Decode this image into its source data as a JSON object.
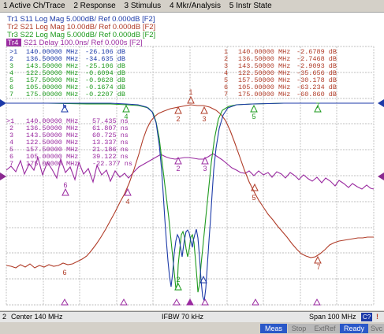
{
  "menu": [
    "1 Active Ch/Trace",
    "2 Response",
    "3 Stimulus",
    "4 Mkr/Analysis",
    "5 Instr State"
  ],
  "traces": [
    {
      "label": "Tr1 S11 Log Mag 5.000dB/ Ref 0.000dB [F2]",
      "color": "#1c3aa8"
    },
    {
      "label": "Tr2 S21 Log Mag 10.00dB/ Ref 0.000dB [F2]",
      "color": "#b03c28"
    },
    {
      "label": "Tr3 S22 Log Mag 5.000dB/ Ref 0.000dB [F2]",
      "color": "#1e9a1e"
    },
    {
      "tag": "Tr4",
      "label": "S21 Delay 100.0ns/ Ref 0.000s [F2]",
      "color": "#9a2aa0"
    }
  ],
  "marker_tables": {
    "s11": {
      "color": "#1c3aa8",
      "rows": [
        {
          "n": ">1",
          "freq": "140.00000 MHz",
          "val": "-26.106 dB"
        },
        {
          "n": "2",
          "freq": "136.50000 MHz",
          "val": "-34.635 dB"
        }
      ]
    },
    "s22": {
      "color": "#1e9a1e",
      "rows": [
        {
          "n": "3",
          "freq": "143.50000 MHz",
          "val": "-25.106 dB"
        },
        {
          "n": "4",
          "freq": "122.50000 MHz",
          "val": "-0.6094 dB"
        },
        {
          "n": "5",
          "freq": "157.50000 MHz",
          "val": "-0.9628 dB"
        },
        {
          "n": "6",
          "freq": "105.00000 MHz",
          "val": "-0.1674 dB"
        },
        {
          "n": "7",
          "freq": "175.00000 MHz",
          "val": "-0.2207 dB"
        }
      ]
    },
    "s21": {
      "color": "#b03c28",
      "rows": [
        {
          "n": "1",
          "freq": "140.00000 MHz",
          "val": "-2.6789 dB"
        },
        {
          "n": "2",
          "freq": "136.50000 MHz",
          "val": "-2.7468 dB"
        },
        {
          "n": "3",
          "freq": "143.50000 MHz",
          "val": "-2.9093 dB"
        },
        {
          "n": "4",
          "freq": "122.50000 MHz",
          "val": "-35.656 dB"
        },
        {
          "n": "5",
          "freq": "157.50000 MHz",
          "val": "-30.178 dB"
        },
        {
          "n": "6",
          "freq": "105.00000 MHz",
          "val": "-63.234 dB"
        },
        {
          "n": "7",
          "freq": "175.00000 MHz",
          "val": "-60.860 dB"
        }
      ]
    },
    "delay": {
      "color": "#9a2aa0",
      "rows": [
        {
          "n": ">1",
          "freq": "140.00000 MHz",
          "val": "57.435 ns"
        },
        {
          "n": "2",
          "freq": "136.50000 MHz",
          "val": "61.807 ns"
        },
        {
          "n": "3",
          "freq": "143.50000 MHz",
          "val": "60.725 ns"
        },
        {
          "n": "4",
          "freq": "122.50000 MHz",
          "val": "13.337 ns"
        },
        {
          "n": "5",
          "freq": "157.50000 MHz",
          "val": "21.186 ns"
        },
        {
          "n": "6",
          "freq": "105.00000 MHz",
          "val": "39.122 ns"
        },
        {
          "n": "7",
          "freq": "175.00000 MHz",
          "val": "-22.377 ns"
        }
      ]
    }
  },
  "status": {
    "channel": "2",
    "center": "Center 140 MHz",
    "ifbw": "IFBW 70 kHz",
    "span": "Span 100 MHz",
    "cal": "C?",
    "arrow": "!"
  },
  "indicators": [
    "Meas",
    "Stop",
    "ExtRef",
    "Ready",
    "Svc"
  ],
  "colors": {
    "grid": "#a8a8a8",
    "bg": "#ffffff",
    "ref_arrow": "#1c3aa8",
    "ref_arrow2": "#8a2a90",
    "marker_tri": "#9a2aa0"
  }
}
